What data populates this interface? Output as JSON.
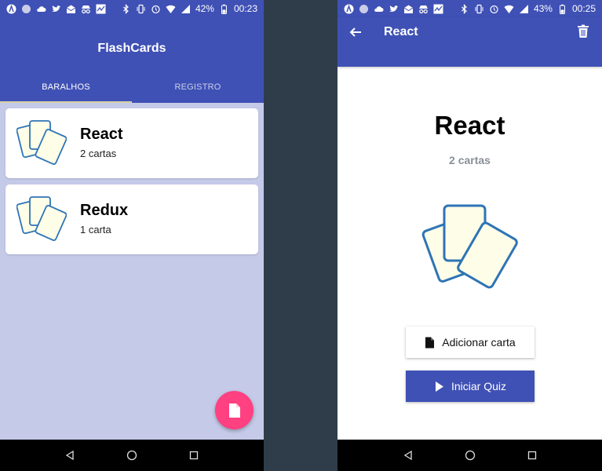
{
  "left": {
    "statusbar": {
      "battery": "42%",
      "time": "00:23"
    },
    "appbar": {
      "title": "FlashCards"
    },
    "tabs": [
      {
        "label": "BARALHOS"
      },
      {
        "label": "REGISTRO"
      }
    ],
    "decks": [
      {
        "name": "React",
        "count": "2 cartas"
      },
      {
        "name": "Redux",
        "count": "1 carta"
      }
    ]
  },
  "right": {
    "statusbar": {
      "battery": "43%",
      "time": "00:25"
    },
    "appbar": {
      "title": "React"
    },
    "deck": {
      "title": "React",
      "count": "2 cartas"
    },
    "buttons": {
      "add_card": "Adicionar carta",
      "start_quiz": "Iniciar Quiz"
    }
  },
  "colors": {
    "primary": "#3f51b5",
    "accent": "#ff4081",
    "list_bg": "#c5cae9",
    "card_stroke": "#2e74b5",
    "card_fill": "#fdfde8"
  },
  "icons": [
    "back-arrow-icon",
    "trash-icon",
    "file-icon",
    "play-icon",
    "cards-icon",
    "nav-back-icon",
    "nav-home-icon",
    "nav-recents-icon"
  ]
}
